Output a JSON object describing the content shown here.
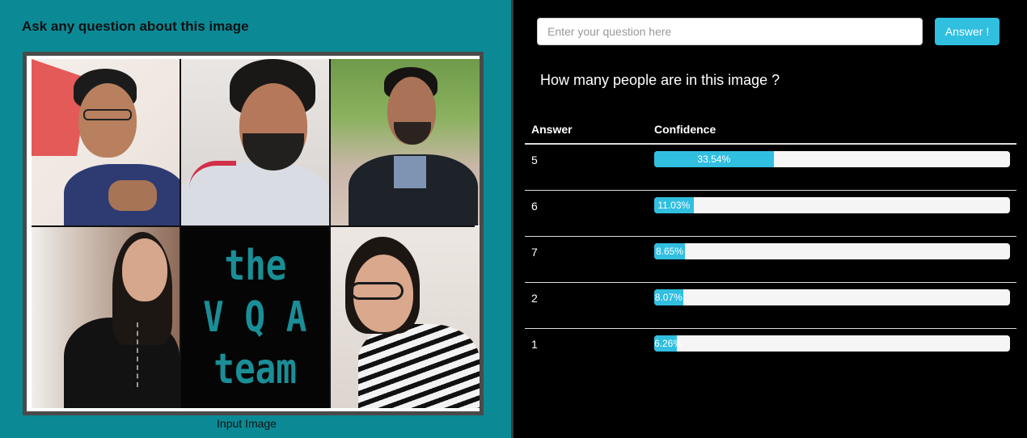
{
  "left_panel": {
    "title": "Ask any question about this image",
    "image_caption": "Input Image",
    "collage_text": [
      "the",
      "V Q A",
      "team"
    ]
  },
  "right_panel": {
    "input_placeholder": "Enter your question here",
    "input_value": "",
    "answer_button": "Answer !",
    "question": "How many people are in this image ?",
    "table": {
      "headers": [
        "Answer",
        "Confidence"
      ],
      "rows": [
        {
          "answer": "5",
          "confidence": "33.54%",
          "value": 33.54
        },
        {
          "answer": "6",
          "confidence": "11.03%",
          "value": 11.03
        },
        {
          "answer": "7",
          "confidence": "8.65%",
          "value": 8.65
        },
        {
          "answer": "2",
          "confidence": "8.07%",
          "value": 8.07
        },
        {
          "answer": "1",
          "confidence": "6.26%",
          "value": 6.26
        }
      ]
    }
  },
  "colors": {
    "left_bg": "#0b8a96",
    "accent": "#31bfe0",
    "team_text": "#1a8e97"
  }
}
